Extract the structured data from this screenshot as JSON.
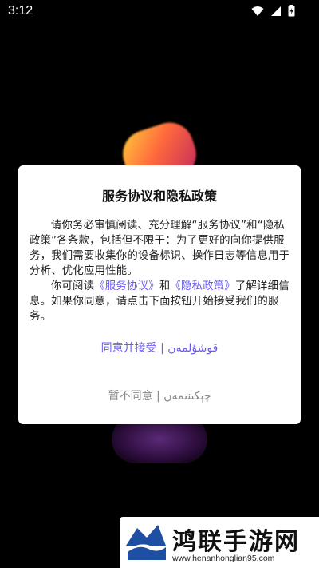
{
  "status": {
    "time": "3:12"
  },
  "dialog": {
    "title": "服务协议和隐私政策",
    "para1": "请你务必审慎阅读、充分理解“服务协议”和“隐私政策”各条款，包括但不限于：为了更好的向你提供服务，我们需要收集你的设备标识、操作日志等信息用于分析、优化应用性能。",
    "para2_prefix": "你可阅读",
    "link_service": "《服务协议》",
    "para2_and": "和",
    "link_privacy": "《隐私政策》",
    "para2_suffix": "了解详细信息。如果你同意，请点击下面按钮开始接受我们的服务。",
    "agree_label": "同意并接受 | قوشۇلمەن",
    "disagree_label": "暂不同意 | چېكىنىمەن"
  },
  "watermark": {
    "title": "鸿联手游网",
    "url": "www.henanhonglian95.com"
  },
  "icons": [
    "wifi-icon",
    "signal-icon",
    "battery-icon"
  ]
}
